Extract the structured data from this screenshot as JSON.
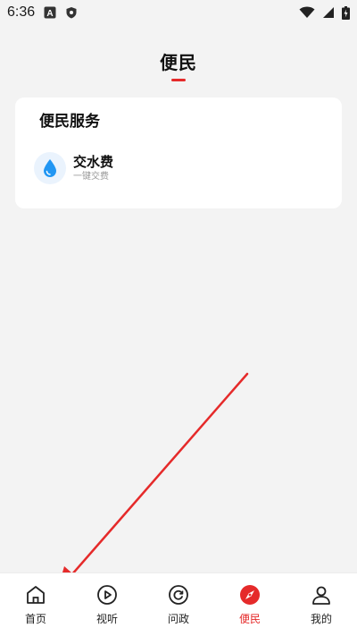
{
  "status_bar": {
    "time": "6:36",
    "icons": [
      "a-notification-icon",
      "shield-icon",
      "wifi-icon",
      "signal-icon",
      "battery-charging-icon"
    ]
  },
  "page": {
    "title": "便民",
    "accent_color": "#e52a2a"
  },
  "service_card": {
    "title": "便民服务",
    "items": [
      {
        "name": "交水费",
        "subtitle": "一键交费",
        "icon": "water-drop-icon",
        "icon_color": "#2196f3"
      }
    ]
  },
  "bottom_nav": {
    "items": [
      {
        "label": "首页",
        "icon": "home-icon"
      },
      {
        "label": "视听",
        "icon": "play-circle-icon"
      },
      {
        "label": "问政",
        "icon": "refresh-circle-icon"
      },
      {
        "label": "便民",
        "icon": "compass-icon",
        "active": true
      },
      {
        "label": "我的",
        "icon": "user-icon"
      }
    ]
  }
}
